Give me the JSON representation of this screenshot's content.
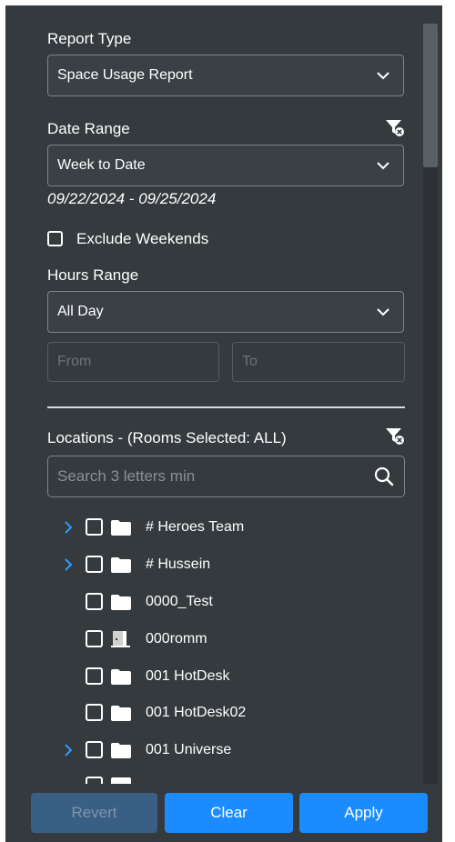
{
  "report_type": {
    "label": "Report Type",
    "selected": "Space Usage Report"
  },
  "date_range": {
    "label": "Date Range",
    "selected": "Week to Date",
    "range_text": "09/22/2024 - 09/25/2024",
    "exclude_weekends_label": "Exclude Weekends",
    "exclude_weekends_checked": false
  },
  "hours_range": {
    "label": "Hours Range",
    "selected": "All Day",
    "from_placeholder": "From",
    "to_placeholder": "To"
  },
  "locations": {
    "label": "Locations - (Rooms Selected: ALL)",
    "search_placeholder": "Search 3 letters min",
    "items": [
      {
        "name": "# Heroes Team",
        "icon": "folder-icon",
        "expandable": true
      },
      {
        "name": "# Hussein",
        "icon": "folder-icon",
        "expandable": true
      },
      {
        "name": "0000_Test",
        "icon": "folder-icon",
        "expandable": false
      },
      {
        "name": "000romm",
        "icon": "door-icon",
        "expandable": false
      },
      {
        "name": "001 HotDesk",
        "icon": "folder-icon",
        "expandable": false
      },
      {
        "name": "001 HotDesk02",
        "icon": "folder-icon",
        "expandable": false
      },
      {
        "name": "001 Universe",
        "icon": "folder-icon",
        "expandable": true
      }
    ]
  },
  "buttons": {
    "revert": "Revert",
    "clear": "Clear",
    "apply": "Apply"
  },
  "colors": {
    "panel_bg": "#353a3f",
    "accent_blue": "#1a8cff",
    "revert_disabled": "#3a5f84",
    "expander_blue": "#2f9bff"
  }
}
